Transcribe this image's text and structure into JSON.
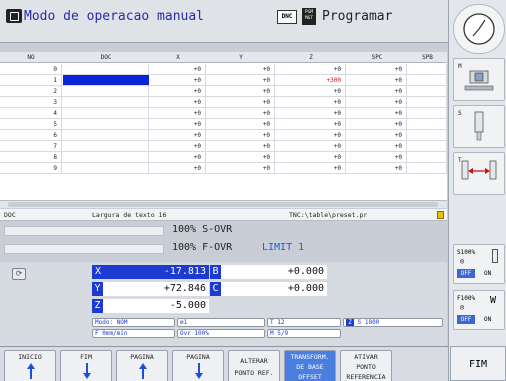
{
  "header": {
    "title": "Modo de operacao manual",
    "dnc_badge": "DNC",
    "pgm_badge_line1": "PGM",
    "pgm_badge_line2": "MGT",
    "program_label": "Programar"
  },
  "table": {
    "columns": [
      "NO",
      "DOC",
      "X",
      "Y",
      "Z",
      "SPC",
      "SPB"
    ],
    "rows": [
      {
        "no": "0",
        "x": "+0",
        "y": "+0",
        "z": "+0",
        "spc": "+0"
      },
      {
        "no": "1",
        "x": "+0",
        "y": "+0",
        "z": "+300",
        "spc": "+0"
      },
      {
        "no": "2",
        "x": "+0",
        "y": "+0",
        "z": "+0",
        "spc": "+0"
      },
      {
        "no": "3",
        "x": "+0",
        "y": "+0",
        "z": "+0",
        "spc": "+0"
      },
      {
        "no": "4",
        "x": "+0",
        "y": "+0",
        "z": "+0",
        "spc": "+0"
      },
      {
        "no": "5",
        "x": "+0",
        "y": "+0",
        "z": "+0",
        "spc": "+0"
      },
      {
        "no": "6",
        "x": "+0",
        "y": "+0",
        "z": "+0",
        "spc": "+0"
      },
      {
        "no": "7",
        "x": "+0",
        "y": "+0",
        "z": "+0",
        "spc": "+0"
      },
      {
        "no": "8",
        "x": "+0",
        "y": "+0",
        "z": "+0",
        "spc": "+0"
      },
      {
        "no": "9",
        "x": "+0",
        "y": "+0",
        "z": "+0",
        "spc": "+0"
      }
    ]
  },
  "statusline": {
    "field": "DOC",
    "text_width": "Largura de texto 16",
    "path": "TNC:\\table\\preset.pr"
  },
  "overrides": {
    "spindle": "100% S-OVR",
    "feed": "100% F-OVR",
    "limit": "LIMIT 1"
  },
  "positions": {
    "x": {
      "axis": "X",
      "value": "-17.813"
    },
    "y": {
      "axis": "Y",
      "value": "+72.846"
    },
    "z": {
      "axis": "Z",
      "value": "-5.000"
    },
    "b": {
      "axis": "B",
      "value": "+0.000"
    },
    "c": {
      "axis": "C",
      "value": "+0.000"
    }
  },
  "status": {
    "mode": "Modo: NOM",
    "tool_count": "1",
    "tool": "T 12",
    "spindle_axis": "Z",
    "spindle_speed": "S 1800",
    "feed": "F 0mm/min",
    "feed_ovr": "Ovr 100%",
    "mfunc": "M 5/9"
  },
  "right_panel": {
    "m_label": "M",
    "s_label": "S",
    "t_label": "T",
    "s_ovr": "S100%",
    "f_ovr": "F100%",
    "off": "OFF",
    "on": "ON"
  },
  "softkeys": {
    "inicio": "INICIO",
    "fim": "FIM",
    "pagina1": "PAGINA",
    "pagina2": "PAGINA",
    "alterar_line1": "ALTERAR",
    "alterar_line2": "PONTO REF.",
    "transform_line1": "TRANSFORM.",
    "transform_line2": "DE BASE",
    "transform_line3": "OFFSET",
    "ativar_line1": "ATIVAR",
    "ativar_line2": "PONTO",
    "ativar_line3": "REFERENCIA",
    "fim_right": "FIM"
  },
  "colors": {
    "accent_blue": "#1d3bd0",
    "title_blue": "#2a2aa8",
    "highlight_red": "#d01010"
  }
}
